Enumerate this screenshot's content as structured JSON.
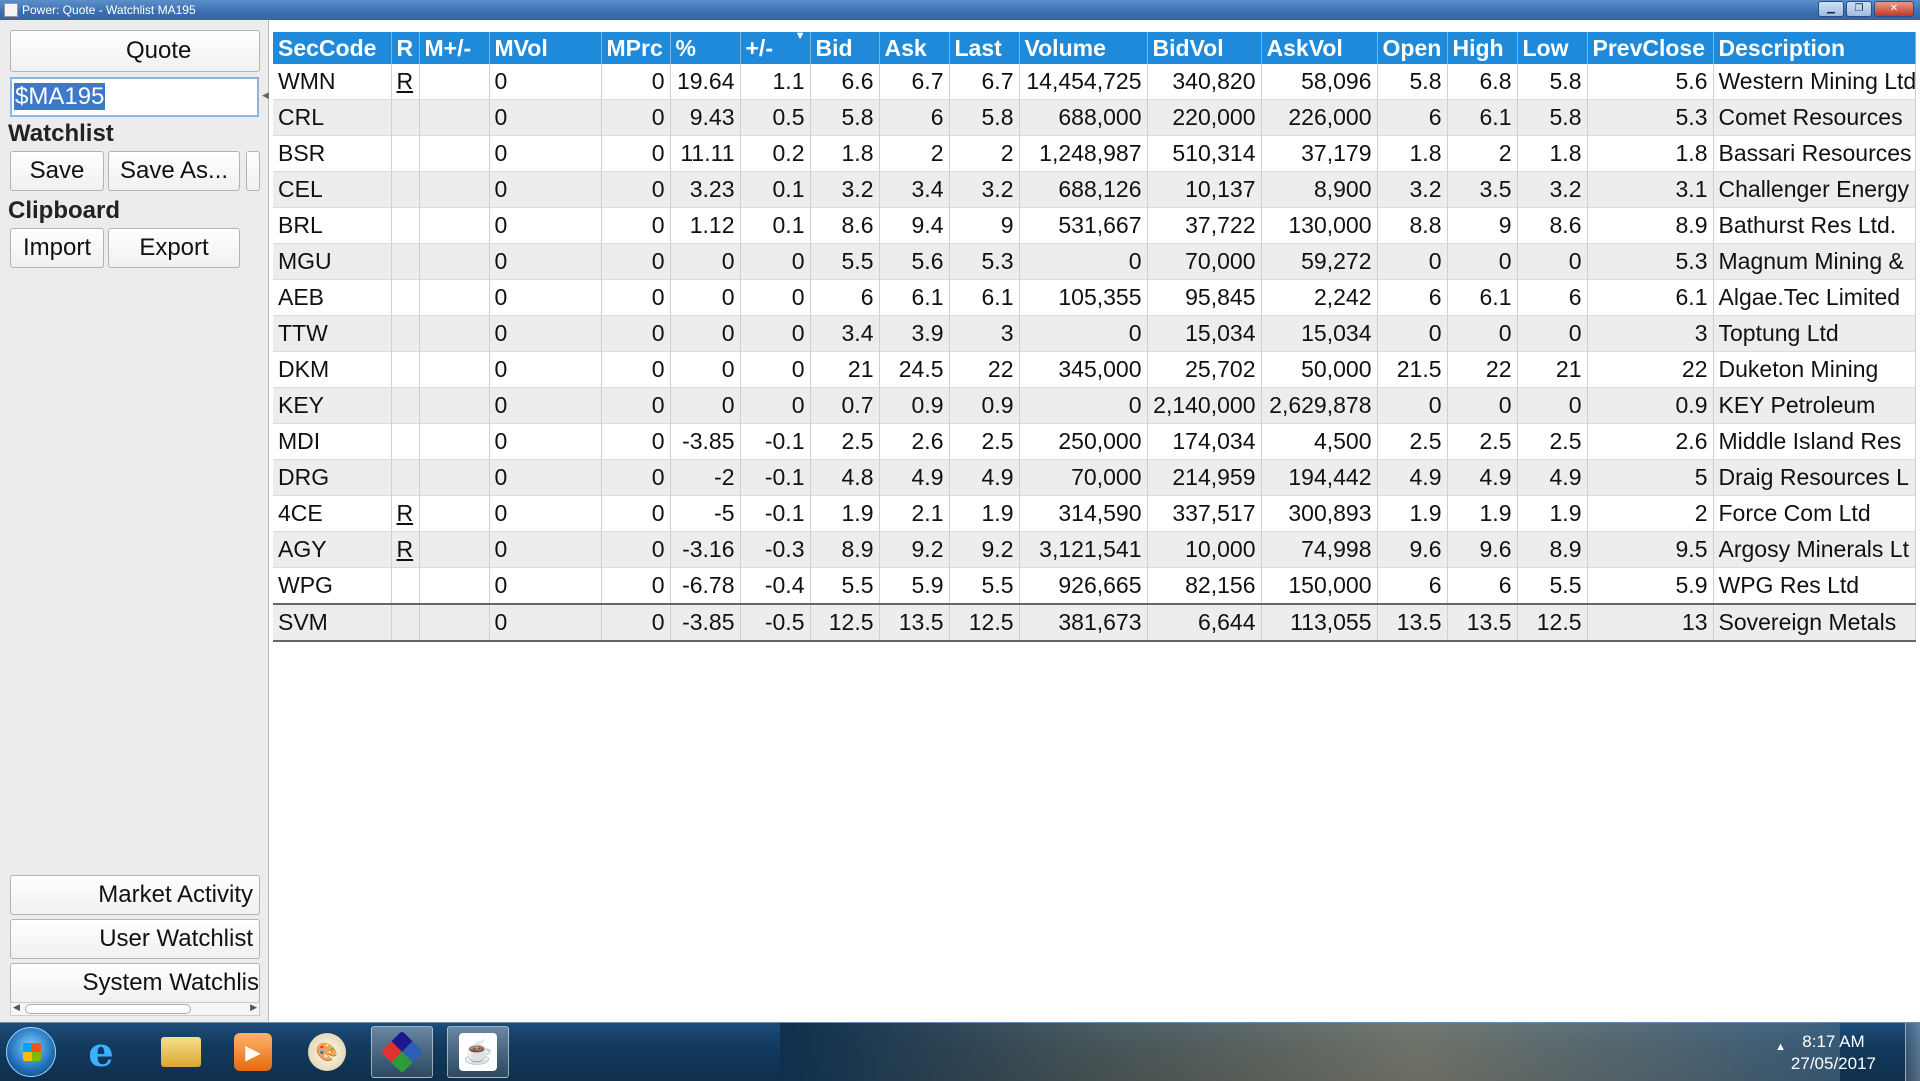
{
  "window": {
    "title": "Power: Quote - Watchlist MA195"
  },
  "left": {
    "quote_button": "Quote",
    "quote_input": "$MA195",
    "watchlist_label": "Watchlist",
    "save": "Save",
    "save_as": "Save As...",
    "clipboard_label": "Clipboard",
    "import": "Import",
    "export": "Export",
    "market_activity": "Market Activity",
    "user_watchlist": "User Watchlist",
    "system_watchlist": "System Watchlis"
  },
  "columns": [
    "SecCode",
    "R",
    "M+/-",
    "MVol",
    "MPrc",
    "%",
    "+/-",
    "Bid",
    "Ask",
    "Last",
    "Volume",
    "BidVol",
    "AskVol",
    "Open",
    "High",
    "Low",
    "PrevClose",
    "Description"
  ],
  "rows": [
    [
      "WMN",
      "R",
      "",
      "0",
      "0",
      "19.64",
      "1.1",
      "6.6",
      "6.7",
      "6.7",
      "14,454,725",
      "340,820",
      "58,096",
      "5.8",
      "6.8",
      "5.8",
      "5.6",
      "Western Mining Ltd"
    ],
    [
      "CRL",
      "",
      "",
      "0",
      "0",
      "9.43",
      "0.5",
      "5.8",
      "6",
      "5.8",
      "688,000",
      "220,000",
      "226,000",
      "6",
      "6.1",
      "5.8",
      "5.3",
      "Comet Resources"
    ],
    [
      "BSR",
      "",
      "",
      "0",
      "0",
      "11.11",
      "0.2",
      "1.8",
      "2",
      "2",
      "1,248,987",
      "510,314",
      "37,179",
      "1.8",
      "2",
      "1.8",
      "1.8",
      "Bassari Resources"
    ],
    [
      "CEL",
      "",
      "",
      "0",
      "0",
      "3.23",
      "0.1",
      "3.2",
      "3.4",
      "3.2",
      "688,126",
      "10,137",
      "8,900",
      "3.2",
      "3.5",
      "3.2",
      "3.1",
      "Challenger Energy"
    ],
    [
      "BRL",
      "",
      "",
      "0",
      "0",
      "1.12",
      "0.1",
      "8.6",
      "9.4",
      "9",
      "531,667",
      "37,722",
      "130,000",
      "8.8",
      "9",
      "8.6",
      "8.9",
      "Bathurst Res Ltd."
    ],
    [
      "MGU",
      "",
      "",
      "0",
      "0",
      "0",
      "0",
      "5.5",
      "5.6",
      "5.3",
      "0",
      "70,000",
      "59,272",
      "0",
      "0",
      "0",
      "5.3",
      "Magnum Mining &"
    ],
    [
      "AEB",
      "",
      "",
      "0",
      "0",
      "0",
      "0",
      "6",
      "6.1",
      "6.1",
      "105,355",
      "95,845",
      "2,242",
      "6",
      "6.1",
      "6",
      "6.1",
      "Algae.Tec Limited"
    ],
    [
      "TTW",
      "",
      "",
      "0",
      "0",
      "0",
      "0",
      "3.4",
      "3.9",
      "3",
      "0",
      "15,034",
      "15,034",
      "0",
      "0",
      "0",
      "3",
      "Toptung Ltd"
    ],
    [
      "DKM",
      "",
      "",
      "0",
      "0",
      "0",
      "0",
      "21",
      "24.5",
      "22",
      "345,000",
      "25,702",
      "50,000",
      "21.5",
      "22",
      "21",
      "22",
      "Duketon Mining"
    ],
    [
      "KEY",
      "",
      "",
      "0",
      "0",
      "0",
      "0",
      "0.7",
      "0.9",
      "0.9",
      "0",
      "2,140,000",
      "2,629,878",
      "0",
      "0",
      "0",
      "0.9",
      "KEY Petroleum"
    ],
    [
      "MDI",
      "",
      "",
      "0",
      "0",
      "-3.85",
      "-0.1",
      "2.5",
      "2.6",
      "2.5",
      "250,000",
      "174,034",
      "4,500",
      "2.5",
      "2.5",
      "2.5",
      "2.6",
      "Middle Island Res"
    ],
    [
      "DRG",
      "",
      "",
      "0",
      "0",
      "-2",
      "-0.1",
      "4.8",
      "4.9",
      "4.9",
      "70,000",
      "214,959",
      "194,442",
      "4.9",
      "4.9",
      "4.9",
      "5",
      "Draig Resources L"
    ],
    [
      "4CE",
      "R",
      "",
      "0",
      "0",
      "-5",
      "-0.1",
      "1.9",
      "2.1",
      "1.9",
      "314,590",
      "337,517",
      "300,893",
      "1.9",
      "1.9",
      "1.9",
      "2",
      "Force Com Ltd"
    ],
    [
      "AGY",
      "R",
      "",
      "0",
      "0",
      "-3.16",
      "-0.3",
      "8.9",
      "9.2",
      "9.2",
      "3,121,541",
      "10,000",
      "74,998",
      "9.6",
      "9.6",
      "8.9",
      "9.5",
      "Argosy Minerals Lt"
    ],
    [
      "WPG",
      "",
      "",
      "0",
      "0",
      "-6.78",
      "-0.4",
      "5.5",
      "5.9",
      "5.5",
      "926,665",
      "82,156",
      "150,000",
      "6",
      "6",
      "5.5",
      "5.9",
      "WPG Res Ltd"
    ],
    [
      "SVM",
      "",
      "",
      "0",
      "0",
      "-3.85",
      "-0.5",
      "12.5",
      "13.5",
      "12.5",
      "381,673",
      "6,644",
      "113,055",
      "13.5",
      "13.5",
      "12.5",
      "13",
      "Sovereign Metals"
    ]
  ],
  "taskbar": {
    "time": "8:17 AM",
    "date": "27/05/2017",
    "items": [
      "start-orb",
      "internet-explorer-icon",
      "file-explorer-icon",
      "media-player-icon",
      "paint-icon",
      "network-app-icon",
      "java-app-icon"
    ]
  },
  "colors": {
    "header": "#1f8ad9",
    "positive": "#1f9a1f",
    "negative": "#d01010"
  }
}
